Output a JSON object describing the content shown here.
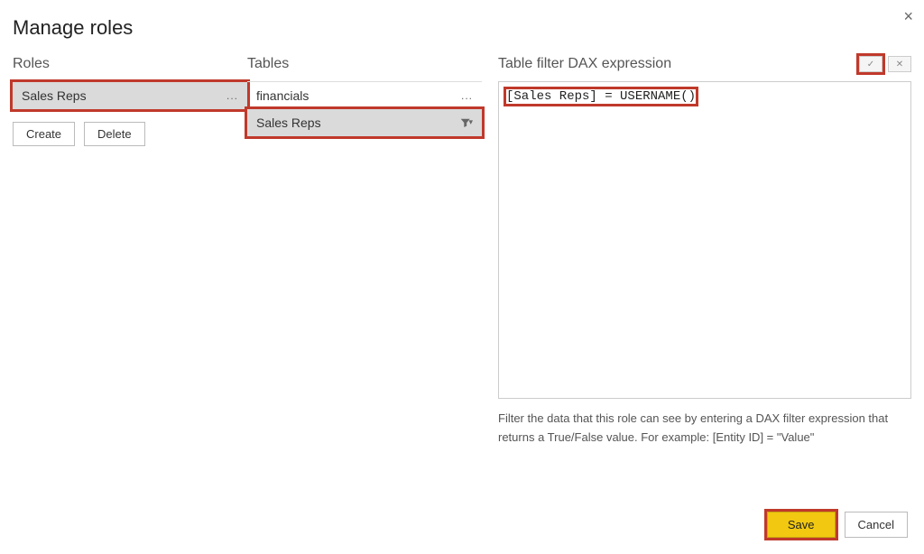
{
  "dialog": {
    "title": "Manage roles"
  },
  "roles": {
    "header": "Roles",
    "items": [
      {
        "name": "Sales Reps",
        "selected": true
      }
    ],
    "create_label": "Create",
    "delete_label": "Delete"
  },
  "tables": {
    "header": "Tables",
    "items": [
      {
        "name": "financials",
        "selected": false,
        "has_filter": false
      },
      {
        "name": "Sales Reps",
        "selected": true,
        "has_filter": true
      }
    ]
  },
  "dax": {
    "header": "Table filter DAX expression",
    "value": "[Sales Reps] = USERNAME()",
    "help": "Filter the data that this role can see by entering a DAX filter expression that returns a True/False value. For example: [Entity ID] = \"Value\"",
    "apply_label": "✓",
    "discard_label": "✕"
  },
  "footer": {
    "save_label": "Save",
    "cancel_label": "Cancel"
  }
}
